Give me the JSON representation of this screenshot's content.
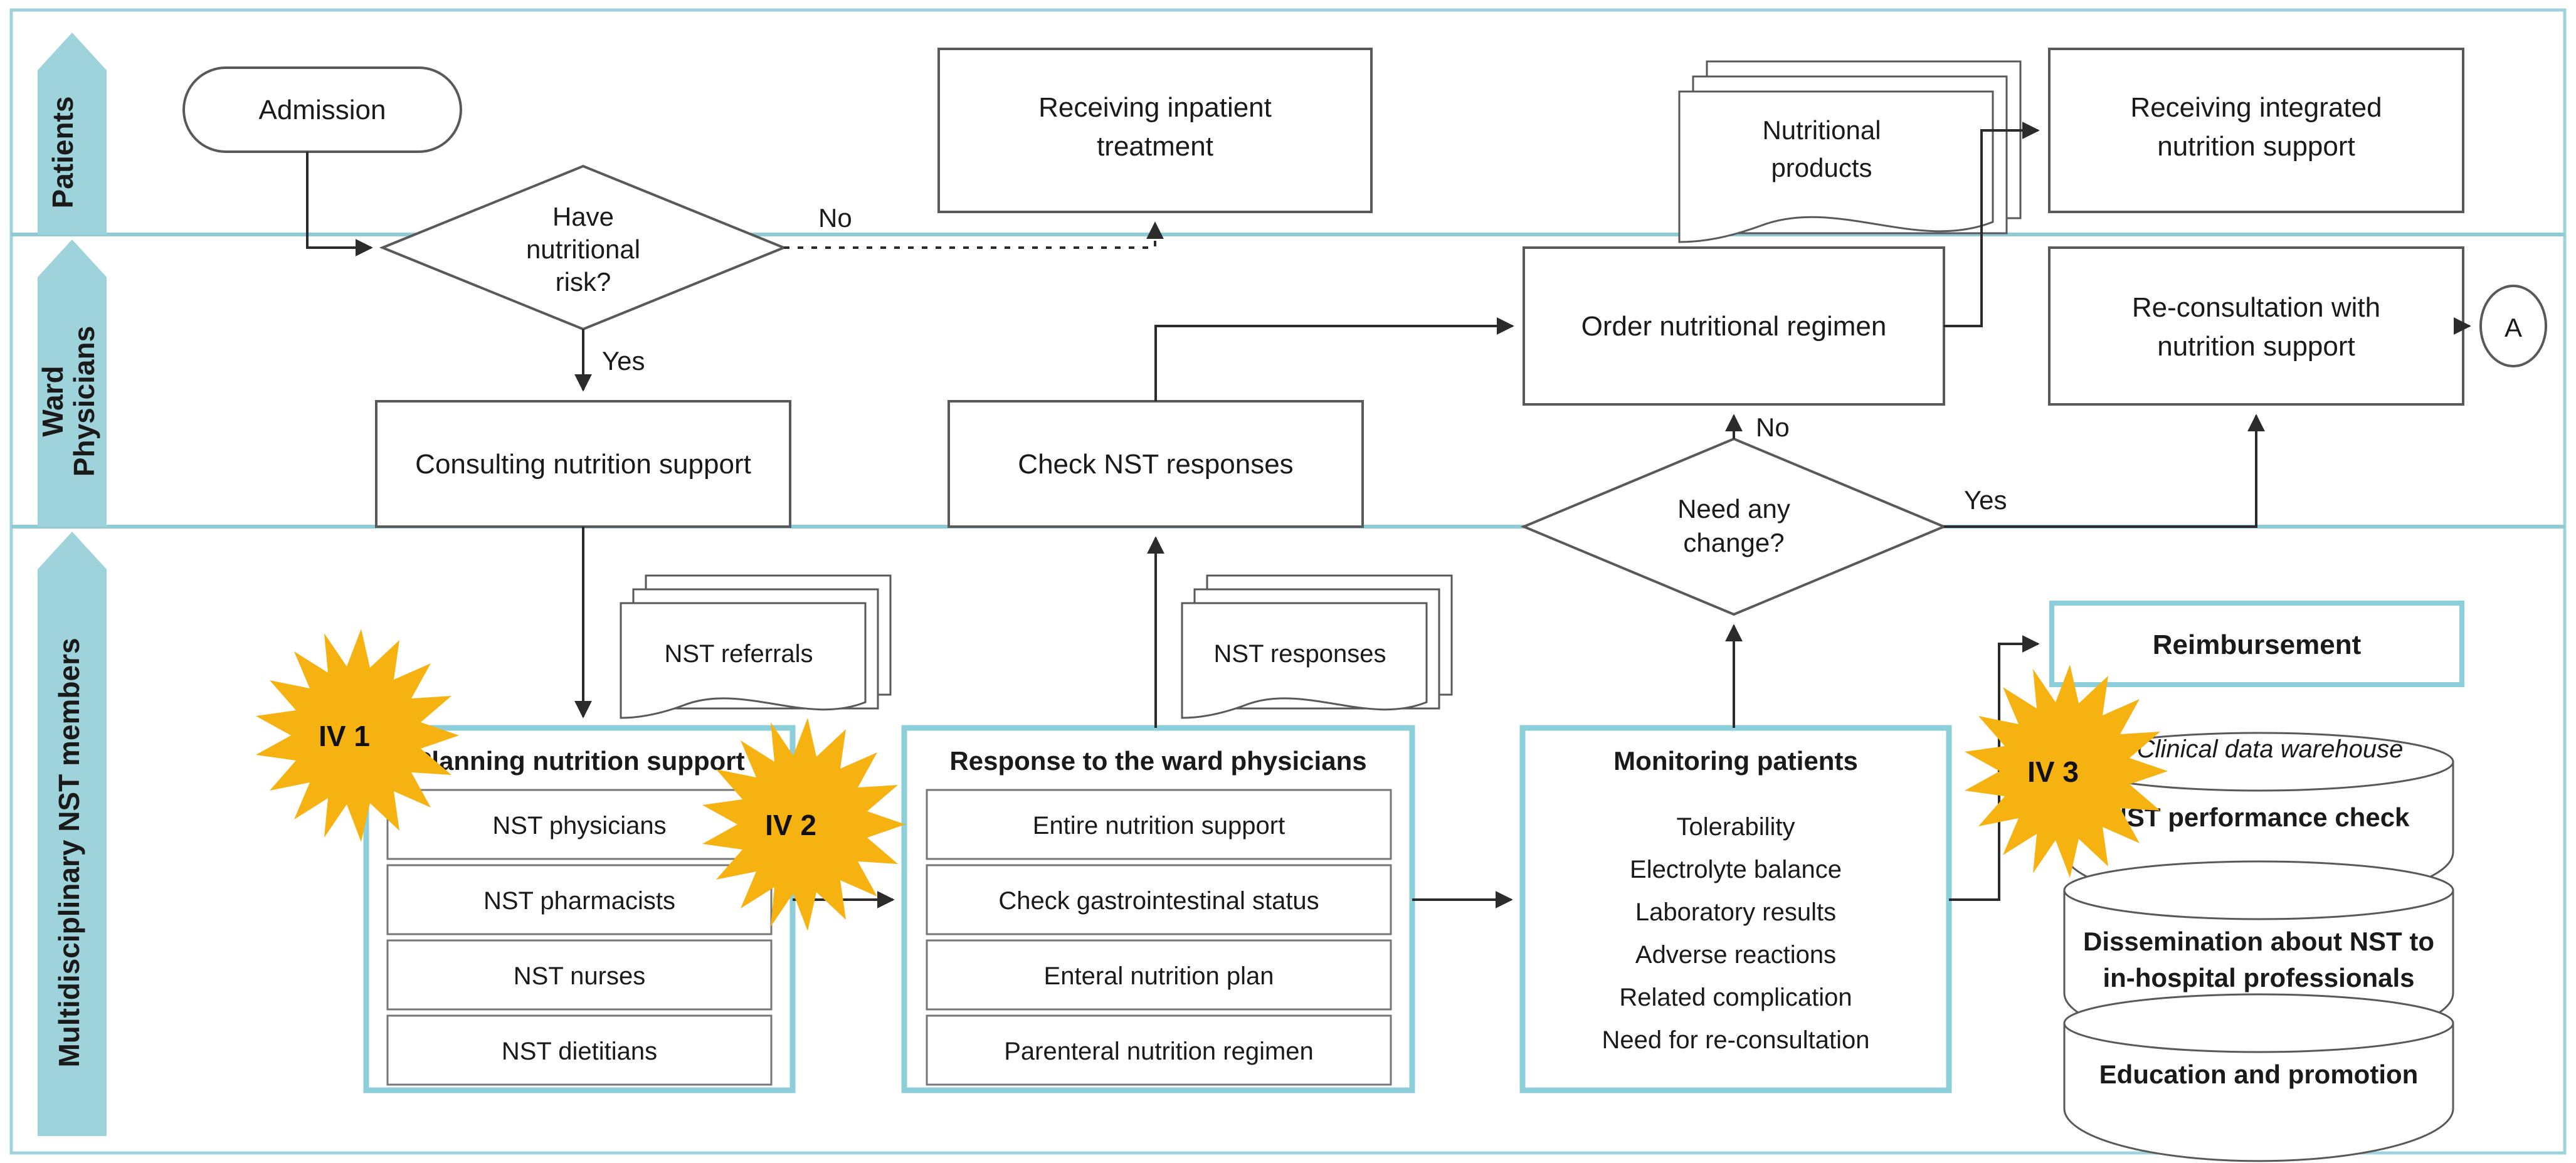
{
  "colors": {
    "lane_fill": "#9FD3DC",
    "lane_border": "#8FCBD6",
    "group_border": "#8CCEDA",
    "shape_stroke": "#595959",
    "shape_fill": "#FFFFFF",
    "badge_fill": "#F5B210",
    "text": "#1A1A1A",
    "outer_border": "#9FD3DC"
  },
  "lanes": [
    {
      "id": "patients",
      "label": "Patients"
    },
    {
      "id": "ward-physicians",
      "label": "Ward\nPhysicians"
    },
    {
      "id": "nst-members",
      "label": "Multidisciplinary NST members"
    }
  ],
  "nodes": {
    "admission": {
      "label": "Admission",
      "shape": "terminator"
    },
    "have_nutritional_risk": {
      "label": "Have\nnutritional\nrisk?",
      "shape": "decision"
    },
    "receiving_inpatient_treatment": {
      "label": "Receiving inpatient\ntreatment",
      "shape": "process"
    },
    "nutritional_products": {
      "label": "Nutritional\nproducts",
      "shape": "multidocument"
    },
    "receiving_integrated_nutrition_support": {
      "label": "Receiving integrated\nnutrition support",
      "shape": "process"
    },
    "order_nutritional_regimen": {
      "label": "Order nutritional regimen",
      "shape": "process"
    },
    "re_consultation_with_nutrition_support": {
      "label": "Re-consultation with\nnutrition support",
      "shape": "process"
    },
    "offpage_a": {
      "label": "A",
      "shape": "connector"
    },
    "consulting_nutrition_support": {
      "label": "Consulting nutrition support",
      "shape": "process"
    },
    "check_nst_responses": {
      "label": "Check NST responses",
      "shape": "process"
    },
    "need_any_change": {
      "label": "Need any\nchange?",
      "shape": "decision"
    },
    "nst_referrals": {
      "label": "NST referrals",
      "shape": "multidocument"
    },
    "nst_responses": {
      "label": "NST responses",
      "shape": "multidocument"
    },
    "reimbursement": {
      "label": "Reimbursement",
      "shape": "highlight-process"
    }
  },
  "groups": {
    "planning": {
      "title": "Planning nutrition support",
      "items": [
        "NST physicians",
        "NST pharmacists",
        "NST nurses",
        "NST dietitians"
      ]
    },
    "response": {
      "title": "Response to the ward physicians",
      "items": [
        "Entire nutrition support",
        "Check gastrointestinal status",
        "Enteral nutrition plan",
        "Parenteral nutrition regimen"
      ]
    },
    "monitoring": {
      "title": "Monitoring patients",
      "items": [
        "Tolerability",
        "Electrolyte balance",
        "Laboratory results",
        "Adverse reactions",
        "Related complication",
        "Need for re-consultation"
      ]
    }
  },
  "datastore": {
    "caption": "Clinical data warehouse",
    "cylinders": [
      "NST performance check",
      "Dissemination about NST to\nin-hospital professionals",
      "Education and promotion"
    ]
  },
  "edge_labels": {
    "no_risk": "No",
    "yes_risk": "Yes",
    "no_change": "No",
    "yes_change": "Yes"
  },
  "badges": [
    {
      "id": "iv1",
      "label": "IV 1"
    },
    {
      "id": "iv2",
      "label": "IV 2"
    },
    {
      "id": "iv3",
      "label": "IV 3"
    }
  ]
}
